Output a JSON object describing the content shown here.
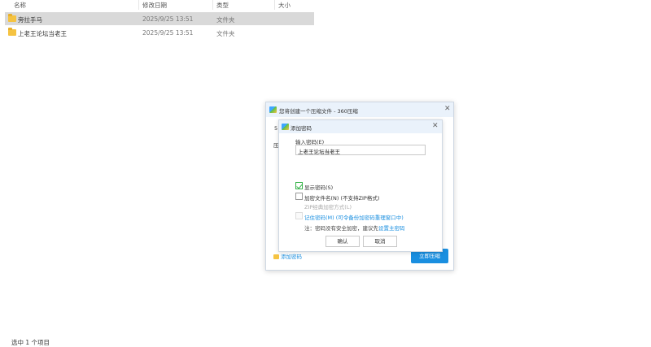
{
  "explorer": {
    "columns": {
      "name": "名称",
      "modified": "修改日期",
      "type": "类型",
      "size": "大小"
    },
    "rows": [
      {
        "name": "旁拉手马",
        "modified": "2025/9/25 13:51",
        "type": "文件夹",
        "size": "",
        "selected": true
      },
      {
        "name": "上老王论坛当老王",
        "modified": "2025/9/25 13:51",
        "type": "文件夹",
        "size": "",
        "selected": false
      }
    ],
    "status": "选中 1 个项目"
  },
  "outer_dialog": {
    "title": "您将创建一个压缩文件 - 360压缩",
    "frag1": "5",
    "frag2": "压",
    "add_password_link": "添加密码",
    "start_button": "立即压缩"
  },
  "password_dialog": {
    "title": "添加密码",
    "label": "输入密码(E)",
    "password_value": "上老王论坛当老王",
    "options": {
      "show_password": "显示密码(S)",
      "encrypt_names": "加密文件名(N) (不支持ZIP格式)",
      "zip_method": "ZIP经典加密方式(L)",
      "remember": "记住密码(M) (可令备份加密码重理窗口中)"
    },
    "note_prefix": "注：密码没有安全加密，建议先",
    "note_link": "设置主密码",
    "ok_button": "确认",
    "cancel_button": "取消"
  }
}
